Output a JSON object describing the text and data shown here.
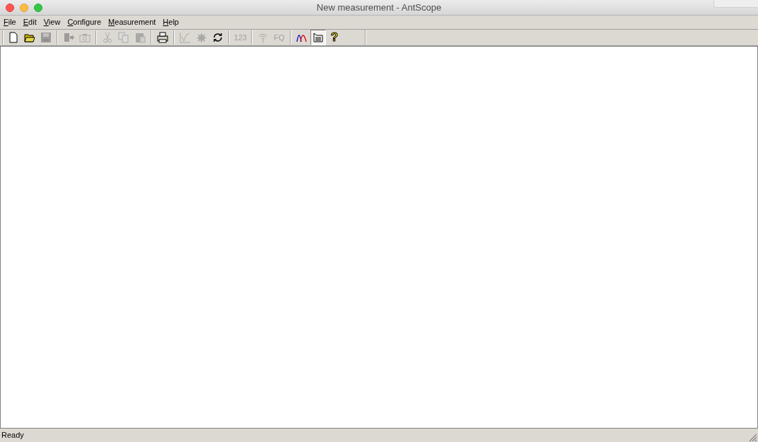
{
  "window": {
    "title": "New measurement - AntScope"
  },
  "menu": [
    "File",
    "Edit",
    "View",
    "Configure",
    "Measurement",
    "Help"
  ],
  "toolbar": [
    {
      "kind": "new",
      "disabled": false,
      "pressed": false
    },
    {
      "kind": "open",
      "disabled": false,
      "pressed": false
    },
    {
      "kind": "save",
      "disabled": true,
      "pressed": false
    },
    {
      "kind": "sep"
    },
    {
      "kind": "export",
      "disabled": true,
      "pressed": false
    },
    {
      "kind": "camera",
      "disabled": true,
      "pressed": false
    },
    {
      "kind": "sep"
    },
    {
      "kind": "cut",
      "disabled": true,
      "pressed": false
    },
    {
      "kind": "copy",
      "disabled": true,
      "pressed": false
    },
    {
      "kind": "paste",
      "disabled": true,
      "pressed": false
    },
    {
      "kind": "sep"
    },
    {
      "kind": "print",
      "disabled": false,
      "pressed": false
    },
    {
      "kind": "sep"
    },
    {
      "kind": "chart",
      "disabled": true,
      "pressed": false
    },
    {
      "kind": "star",
      "disabled": true,
      "pressed": false
    },
    {
      "kind": "refresh",
      "disabled": false,
      "pressed": false
    },
    {
      "kind": "sep"
    },
    {
      "kind": "text",
      "label": "123",
      "disabled": true,
      "pressed": false
    },
    {
      "kind": "sep"
    },
    {
      "kind": "wifi",
      "disabled": true,
      "pressed": false
    },
    {
      "kind": "text",
      "label": "FQ",
      "disabled": true,
      "pressed": false
    },
    {
      "kind": "sep"
    },
    {
      "kind": "curves",
      "disabled": false,
      "pressed": false
    },
    {
      "kind": "list",
      "disabled": false,
      "pressed": true
    },
    {
      "kind": "help",
      "label": "?",
      "disabled": false,
      "pressed": false
    }
  ],
  "status_bar": {
    "text": "Ready"
  }
}
